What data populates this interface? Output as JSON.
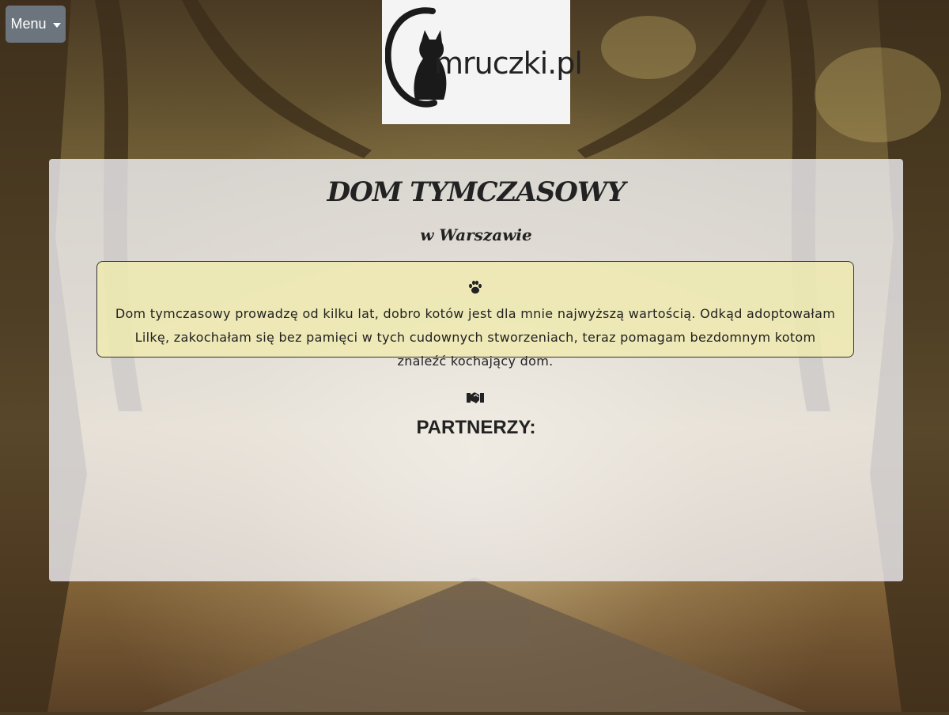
{
  "nav": {
    "menu_label": "Menu"
  },
  "logo": {
    "text": "mruczki.pl"
  },
  "hero": {
    "title": "DOM TYMCZASOWY",
    "subtitle": "w Warszawie"
  },
  "intro": {
    "icon": "paw-icon",
    "text": "Dom tymczasowy prowadzę od kilku lat, dobro kotów jest dla mnie najwyższą wartością. Odkąd adoptowałam Lilkę, zakochałam się bez pamięci w tych cudownych stworzeniach, teraz pomagam bezdomnym kotom znaleźć kochający dom."
  },
  "partners": {
    "icon": "handshake-icon",
    "heading": "PARTNERZY:"
  },
  "colors": {
    "menu_button": "#6c757d",
    "note_background": "#eeeab0",
    "panel_background": "#f5f5fa"
  }
}
